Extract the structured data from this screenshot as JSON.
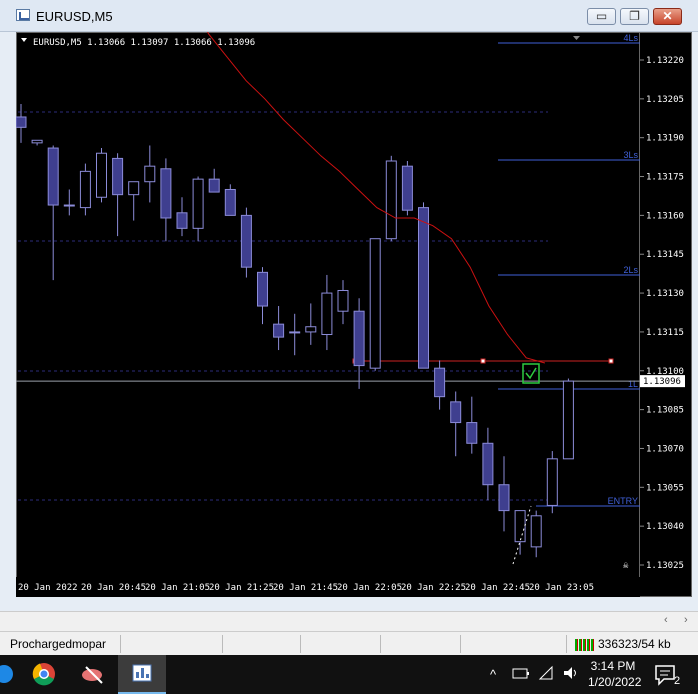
{
  "window": {
    "title": "EURUSD,M5",
    "min": "▭",
    "max": "❐",
    "close": "✕"
  },
  "chart": {
    "header": "EURUSD,M5  1.13066 1.13097 1.13066 1.13096",
    "price_ticks": [
      "1.13220",
      "1.13205",
      "1.13190",
      "1.13175",
      "1.13160",
      "1.13145",
      "1.13130",
      "1.13115",
      "1.13100",
      "1.13085",
      "1.13070",
      "1.13055",
      "1.13040",
      "1.13025"
    ],
    "current_price": "1.13096",
    "time_ticks": [
      "20 Jan 2022",
      "20 Jan 20:45",
      "20 Jan 21:05",
      "20 Jan 21:25",
      "20 Jan 21:45",
      "20 Jan 22:05",
      "20 Jan 22:25",
      "20 Jan 22:45",
      "20 Jan 23:05"
    ],
    "levels": {
      "l4": "4Ls",
      "l3": "3Ls",
      "l2": "2Ls",
      "l1": "1L",
      "entry": "ENTRY"
    },
    "colors": {
      "bull": "#8c8cd9",
      "bear": "#3f3f8f",
      "ma": "#cc1111",
      "level": "#4060d8",
      "grid": "#2d2d7a"
    },
    "candles": [
      {
        "o": 1.13198,
        "h": 1.13203,
        "l": 1.13188,
        "c": 1.13194
      },
      {
        "o": 1.13188,
        "h": 1.13189,
        "l": 1.13187,
        "c": 1.13189
      },
      {
        "o": 1.13186,
        "h": 1.13187,
        "l": 1.13135,
        "c": 1.13164
      },
      {
        "o": 1.13164,
        "h": 1.1317,
        "l": 1.1316,
        "c": 1.13164
      },
      {
        "o": 1.13163,
        "h": 1.1318,
        "l": 1.1316,
        "c": 1.13177
      },
      {
        "o": 1.13167,
        "h": 1.13186,
        "l": 1.13165,
        "c": 1.13184
      },
      {
        "o": 1.13182,
        "h": 1.13184,
        "l": 1.13152,
        "c": 1.13168
      },
      {
        "o": 1.13168,
        "h": 1.13172,
        "l": 1.13158,
        "c": 1.13173
      },
      {
        "o": 1.13173,
        "h": 1.13187,
        "l": 1.13165,
        "c": 1.13179
      },
      {
        "o": 1.13178,
        "h": 1.13182,
        "l": 1.1315,
        "c": 1.13159
      },
      {
        "o": 1.13161,
        "h": 1.13167,
        "l": 1.13152,
        "c": 1.13155
      },
      {
        "o": 1.13155,
        "h": 1.13175,
        "l": 1.1315,
        "c": 1.13174
      },
      {
        "o": 1.13174,
        "h": 1.13178,
        "l": 1.1317,
        "c": 1.13169
      },
      {
        "o": 1.1317,
        "h": 1.13172,
        "l": 1.1316,
        "c": 1.1316
      },
      {
        "o": 1.1316,
        "h": 1.13163,
        "l": 1.13136,
        "c": 1.1314
      },
      {
        "o": 1.13138,
        "h": 1.1314,
        "l": 1.13118,
        "c": 1.13125
      },
      {
        "o": 1.13118,
        "h": 1.13125,
        "l": 1.13108,
        "c": 1.13113
      },
      {
        "o": 1.13115,
        "h": 1.13122,
        "l": 1.13106,
        "c": 1.13115
      },
      {
        "o": 1.13115,
        "h": 1.13126,
        "l": 1.1311,
        "c": 1.13117
      },
      {
        "o": 1.13114,
        "h": 1.13137,
        "l": 1.13108,
        "c": 1.1313
      },
      {
        "o": 1.13123,
        "h": 1.13135,
        "l": 1.13118,
        "c": 1.13131
      },
      {
        "o": 1.13123,
        "h": 1.13128,
        "l": 1.13093,
        "c": 1.13102
      },
      {
        "o": 1.13101,
        "h": 1.13149,
        "l": 1.131,
        "c": 1.13151
      },
      {
        "o": 1.13151,
        "h": 1.13183,
        "l": 1.1315,
        "c": 1.13181
      },
      {
        "o": 1.13179,
        "h": 1.13181,
        "l": 1.1316,
        "c": 1.13162
      },
      {
        "o": 1.13163,
        "h": 1.13165,
        "l": 1.13103,
        "c": 1.13101
      },
      {
        "o": 1.13101,
        "h": 1.13104,
        "l": 1.13085,
        "c": 1.1309
      },
      {
        "o": 1.13088,
        "h": 1.13092,
        "l": 1.13067,
        "c": 1.1308
      },
      {
        "o": 1.1308,
        "h": 1.1309,
        "l": 1.13068,
        "c": 1.13072
      },
      {
        "o": 1.13072,
        "h": 1.13078,
        "l": 1.1305,
        "c": 1.13056
      },
      {
        "o": 1.13056,
        "h": 1.13067,
        "l": 1.13038,
        "c": 1.13046
      },
      {
        "o": 1.13034,
        "h": 1.13046,
        "l": 1.13029,
        "c": 1.13046
      },
      {
        "o": 1.13032,
        "h": 1.13046,
        "l": 1.13028,
        "c": 1.13044
      },
      {
        "o": 1.13048,
        "h": 1.13069,
        "l": 1.13045,
        "c": 1.13066
      },
      {
        "o": 1.13066,
        "h": 1.13097,
        "l": 1.13066,
        "c": 1.13096
      }
    ],
    "ma": [
      1.13242,
      1.1323,
      1.13221,
      1.13212,
      1.13205,
      1.13197,
      1.1319,
      1.13183,
      1.13177,
      1.1317,
      1.13163,
      1.13159,
      1.13159,
      1.13156,
      1.13151,
      1.1314,
      1.13125,
      1.13114,
      1.13105,
      1.13103
    ]
  },
  "status": {
    "user": "Prochargedmopar",
    "conn": "336323/54 kb"
  },
  "taskbar": {
    "time": "3:14 PM",
    "date": "1/20/2022",
    "notif_count": "2"
  }
}
